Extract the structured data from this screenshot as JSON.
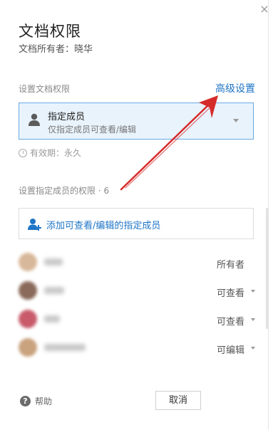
{
  "dialog": {
    "title": "文档权限",
    "owner_label": "文档所有者：",
    "owner_name": "晓华",
    "close_glyph": "×"
  },
  "permission": {
    "section_label": "设置文档权限",
    "advanced_link": "高级设置",
    "selected_main": "指定成员",
    "selected_sub": "仅指定成员可查看/编辑",
    "validity": "有效期：永久"
  },
  "members": {
    "section_label": "设置指定成员的权限 · 6",
    "add_label": "添加可查看/编辑的指定成员",
    "list": [
      {
        "role": "所有者",
        "has_dropdown": false,
        "avatar_color": "#d8b89a"
      },
      {
        "role": "可查看",
        "has_dropdown": true,
        "avatar_color": "#8a6a5a"
      },
      {
        "role": "可查看",
        "has_dropdown": true,
        "avatar_color": "#c85a6a"
      },
      {
        "role": "可编辑",
        "has_dropdown": true,
        "avatar_color": "#c9a27e"
      }
    ]
  },
  "footer": {
    "help_label": "帮助",
    "help_icon_glyph": "?",
    "cancel_label": "取消"
  },
  "colors": {
    "accent": "#1f75c6",
    "annotation_arrow": "#d62b2b",
    "select_bg": "#e9f3fc"
  },
  "icons": {
    "person": "person-icon",
    "add_user": "add-user-icon",
    "clock": "clock-icon",
    "help": "help-icon",
    "close": "close-icon"
  }
}
